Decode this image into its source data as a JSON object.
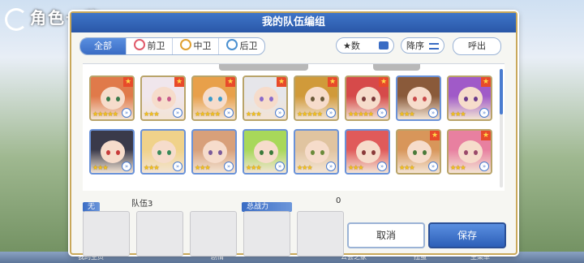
{
  "background": {
    "title": "角色一览",
    "bottom_labels": [
      "我的主页",
      "剧情",
      "公会之家",
      "扭蛋",
      "主菜单"
    ]
  },
  "dialog": {
    "title": "我的队伍编组",
    "filters": [
      {
        "label": "全部",
        "icon": null,
        "active": true
      },
      {
        "label": "前卫",
        "icon": "front-icon",
        "active": false
      },
      {
        "label": "中卫",
        "icon": "mid-icon",
        "active": false
      },
      {
        "label": "后卫",
        "icon": "back-icon",
        "active": false
      }
    ],
    "sort_label": "★数",
    "order_label": "降序",
    "call_label": "呼出",
    "characters": [
      {
        "row": 0,
        "stars": "★★★★★",
        "rank": true,
        "border": "gold",
        "hair": "#e07a4a",
        "eye": "#3a7a4a"
      },
      {
        "row": 0,
        "stars": "★★★",
        "rank": true,
        "border": "gold",
        "hair": "#f0e6ec",
        "eye": "#c85a8a"
      },
      {
        "row": 0,
        "stars": "★★★★★",
        "rank": true,
        "border": "gold",
        "hair": "#e8a04a",
        "eye": "#3a9acb"
      },
      {
        "row": 0,
        "stars": "★★★",
        "rank": true,
        "border": "gold",
        "hair": "#e6e6ea",
        "eye": "#8a6acb"
      },
      {
        "row": 0,
        "stars": "★★★★★",
        "rank": true,
        "border": "gold",
        "hair": "#d09a3a",
        "eye": "#6a5a3a"
      },
      {
        "row": 0,
        "stars": "★★★★★",
        "rank": true,
        "border": "gold",
        "hair": "#d64a4a",
        "eye": "#7a3a3a"
      },
      {
        "row": 0,
        "stars": "★★★",
        "rank": false,
        "border": "blue",
        "hair": "#8a5a3a",
        "eye": "#c84a4a"
      },
      {
        "row": 0,
        "stars": "★★★",
        "rank": true,
        "border": "gold",
        "hair": "#a05ac8",
        "eye": "#6a3a8a"
      },
      {
        "row": 1,
        "stars": "★★★",
        "rank": false,
        "border": "blue",
        "hair": "#3a3a4a",
        "eye": "#c83a3a"
      },
      {
        "row": 1,
        "stars": "★★★",
        "rank": false,
        "border": "blue",
        "hair": "#f0d28a",
        "eye": "#3a8a5a"
      },
      {
        "row": 1,
        "stars": "★★★",
        "rank": false,
        "border": "blue",
        "hair": "#d8a07a",
        "eye": "#7a5a9a"
      },
      {
        "row": 1,
        "stars": "★★★",
        "rank": false,
        "border": "blue",
        "hair": "#a8d85a",
        "eye": "#3a7a3a"
      },
      {
        "row": 1,
        "stars": "★★★",
        "rank": false,
        "border": "blue",
        "hair": "#e0c4a0",
        "eye": "#6a8a3a"
      },
      {
        "row": 1,
        "stars": "★★★",
        "rank": false,
        "border": "blue",
        "hair": "#e05a5a",
        "eye": "#8a3a3a"
      },
      {
        "row": 1,
        "stars": "★★★",
        "rank": true,
        "border": "gold",
        "hair": "#d8965a",
        "eye": "#4a7a3a"
      },
      {
        "row": 1,
        "stars": "★★★",
        "rank": true,
        "border": "gold",
        "hair": "#e880a0",
        "eye": "#9a4a6a"
      }
    ],
    "team_tag": "无",
    "team_name": "队伍3",
    "power_tag": "总战力",
    "power_value": "0",
    "cancel_label": "取消",
    "save_label": "保存"
  }
}
